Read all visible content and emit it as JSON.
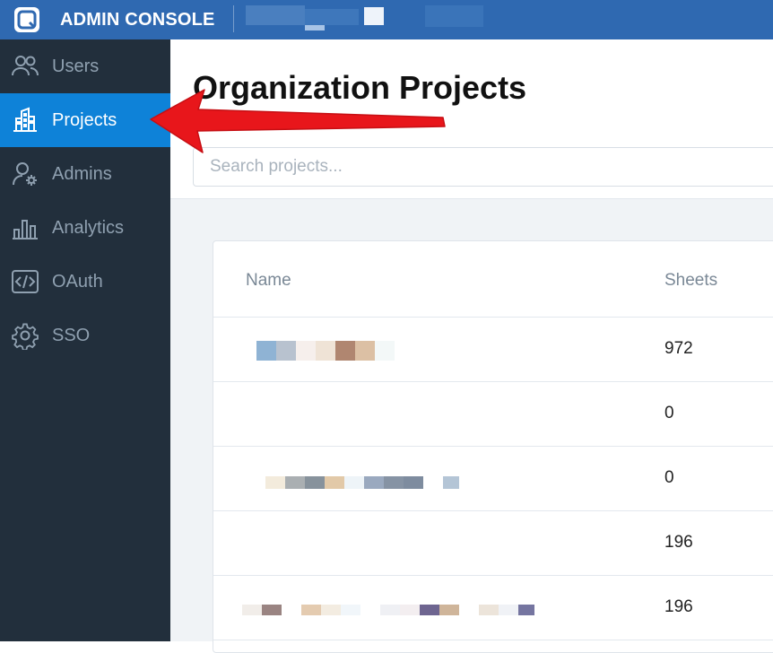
{
  "header": {
    "title": "ADMIN CONSOLE",
    "logo_icon": "app-logo-icon"
  },
  "sidebar": {
    "items": [
      {
        "label": "Users",
        "icon": "users-icon",
        "active": false
      },
      {
        "label": "Projects",
        "icon": "building-icon",
        "active": true
      },
      {
        "label": "Admins",
        "icon": "user-gear-icon",
        "active": false
      },
      {
        "label": "Analytics",
        "icon": "bar-chart-icon",
        "active": false
      },
      {
        "label": "OAuth",
        "icon": "code-icon",
        "active": false
      },
      {
        "label": "SSO",
        "icon": "gear-icon",
        "active": false
      }
    ]
  },
  "main": {
    "title": "Organization Projects",
    "search": {
      "placeholder": "Search projects...",
      "value": ""
    },
    "table": {
      "columns": [
        "Name",
        "Sheets"
      ],
      "rows": [
        {
          "name": "",
          "sheets": "972"
        },
        {
          "name": "",
          "sheets": "0"
        },
        {
          "name": "",
          "sheets": "0"
        },
        {
          "name": "",
          "sheets": "196"
        },
        {
          "name": "",
          "sheets": "196"
        }
      ]
    }
  },
  "colors": {
    "topbar": "#2f69b1",
    "sidebar": "#222f3c",
    "active": "#0e82d8",
    "annotation_arrow": "#e8161b"
  }
}
